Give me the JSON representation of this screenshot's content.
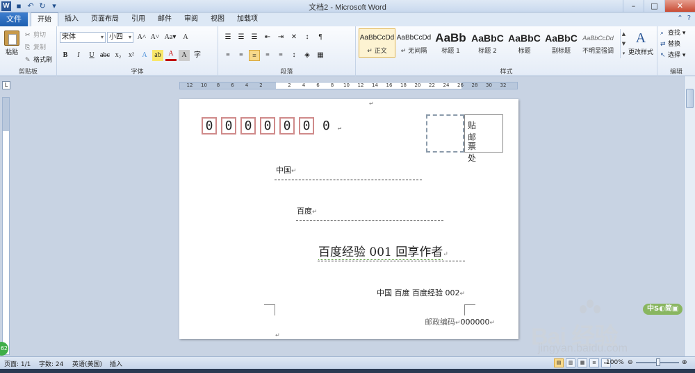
{
  "window": {
    "title": "文档2 - Microsoft Word",
    "app_icon": "W",
    "controls": [
      "–",
      "□",
      "✕"
    ]
  },
  "quick_access": [
    "save-icon",
    "undo-icon",
    "redo-icon"
  ],
  "tabs": {
    "file": "文件",
    "items": [
      "开始",
      "插入",
      "页面布局",
      "引用",
      "邮件",
      "审阅",
      "视图",
      "加载项"
    ],
    "active_index": 0
  },
  "ribbon": {
    "clipboard": {
      "paste": "粘贴",
      "cut": "剪切",
      "copy": "复制",
      "format_painter": "格式刷",
      "group_name": "剪贴板"
    },
    "font": {
      "font_name": "宋体",
      "font_size": "小四",
      "group_name": "字体",
      "row1": [
        "A˄",
        "A˅",
        "Aa▾",
        "A"
      ],
      "row2": [
        "B",
        "I",
        "U",
        "abc",
        "x₂",
        "x²",
        "A",
        "ab",
        "A",
        "A",
        "字"
      ]
    },
    "paragraph": {
      "group_name": "段落",
      "row1": [
        "☰",
        "☰",
        "☰",
        "⇤",
        "⇥",
        "✕",
        "↕",
        "¶"
      ],
      "row2": [
        "≡",
        "≡",
        "≡",
        "≡",
        "≡",
        "↕",
        "◈",
        "▦"
      ]
    },
    "styles": {
      "group_name": "样式",
      "items": [
        {
          "sample": "AaBbCcDd",
          "name": "↵ 正文",
          "active": true
        },
        {
          "sample": "AaBbCcDd",
          "name": "↵ 无间隔",
          "active": false
        },
        {
          "sample": "AaBb",
          "name": "标题 1",
          "active": false
        },
        {
          "sample": "AaBbC",
          "name": "标题 2",
          "active": false
        },
        {
          "sample": "AaBbC",
          "name": "标题",
          "active": false
        },
        {
          "sample": "AaBbC",
          "name": "副标题",
          "active": false
        },
        {
          "sample": "AaBbCcDd",
          "name": "不明显强调",
          "active": false
        }
      ],
      "change_styles": "更改样式"
    },
    "editing": {
      "group_name": "编辑",
      "find": "查找 ▾",
      "replace": "替换",
      "select": "选择 ▾"
    }
  },
  "ruler": {
    "labels": [
      "12",
      "10",
      "8",
      "6",
      "4",
      "2",
      "",
      "2",
      "4",
      "6",
      "8",
      "10",
      "12",
      "14",
      "16",
      "18",
      "20",
      "22",
      "24",
      "26",
      "28",
      "30",
      "32"
    ]
  },
  "document": {
    "zip_digits": [
      "0",
      "0",
      "0",
      "0",
      "0",
      "0",
      "0"
    ],
    "zip_extra": "0",
    "stamp_line1": "贴邮",
    "stamp_line2": "票处",
    "recipient_country": "中国",
    "recipient_city": "百度",
    "recipient_name": "百度经验 001 回享作者",
    "sender": "中国  百度  百度经验 002",
    "postcode_label": "邮政编码",
    "postcode_value": "000000",
    "para_mark": "↵"
  },
  "status": {
    "page": "页面: 1/1",
    "words": "字数: 24",
    "language": "英语(美国)",
    "mode": "插入",
    "zoom": "100%"
  },
  "watermark": {
    "pill": "中S◐简▣",
    "brand": "Bai  经验",
    "url": "jingyan.baidu.com"
  },
  "badge": "62"
}
